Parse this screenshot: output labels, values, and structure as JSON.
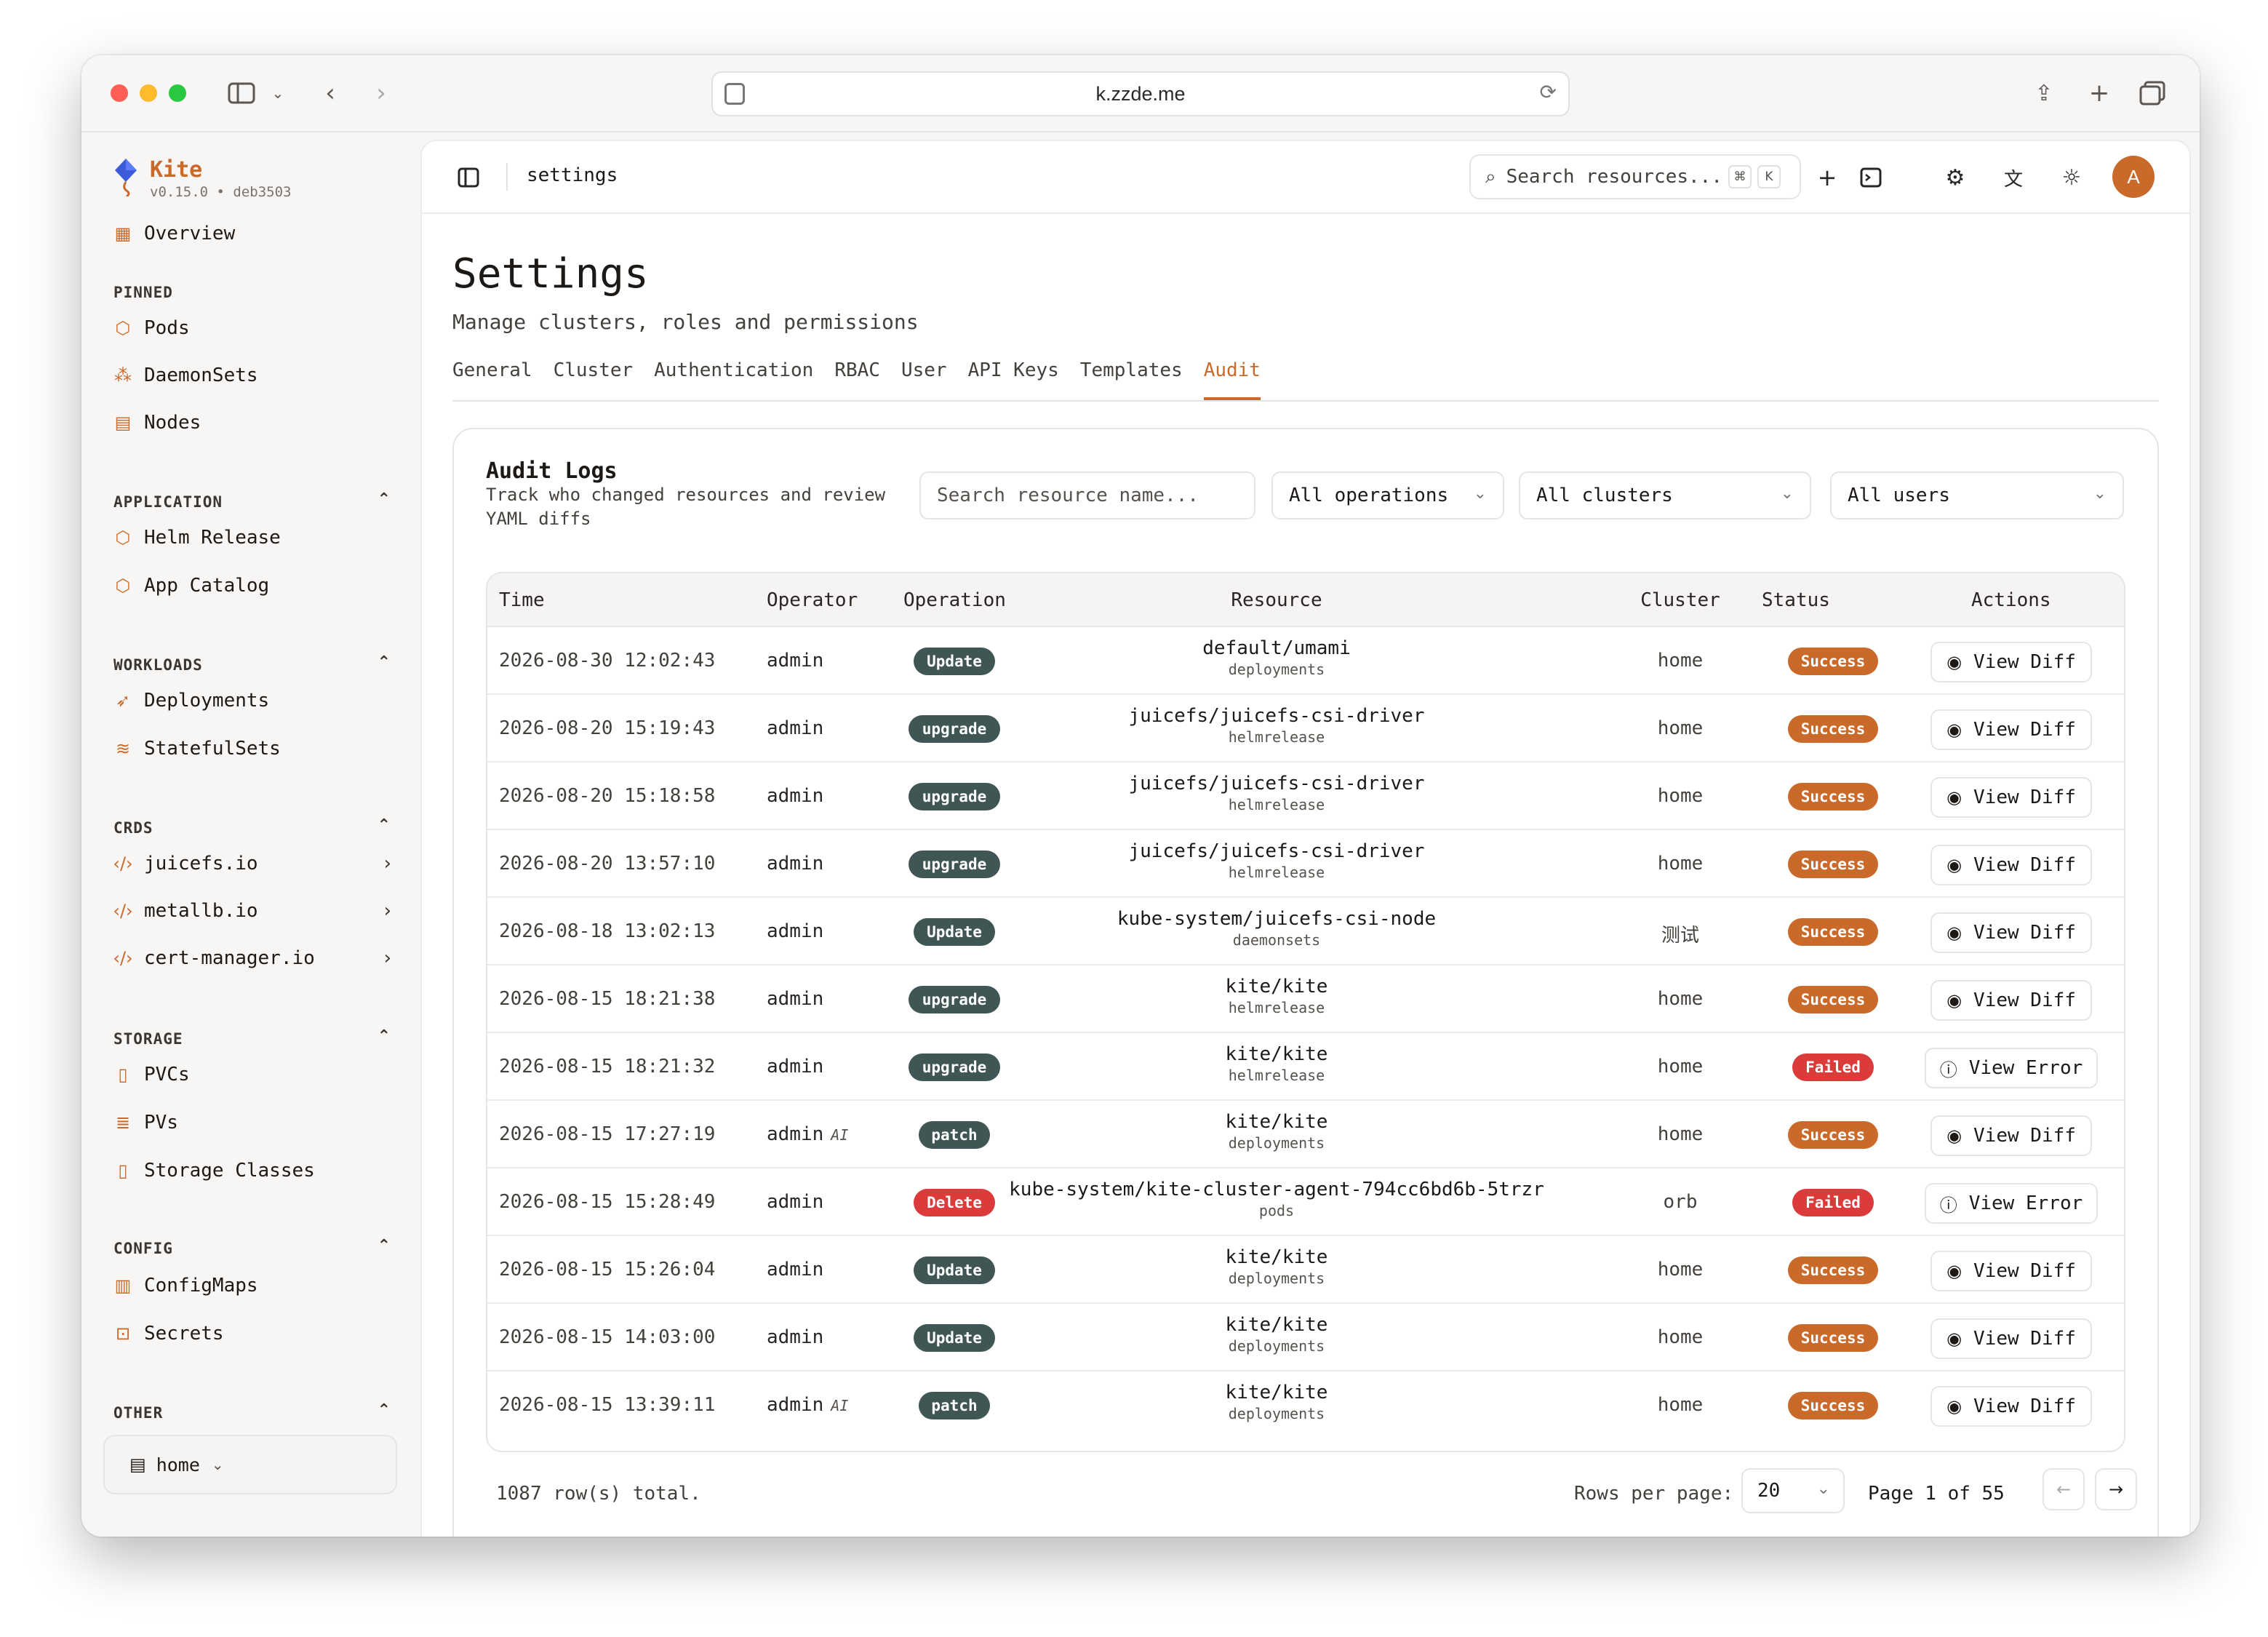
{
  "browser": {
    "url": "k.zzde.me"
  },
  "brand": {
    "name": "Kite",
    "version": "v0.15.0 • deb3503"
  },
  "sidebar": {
    "overview": "Overview",
    "sections": {
      "pinned": "PINNED",
      "application": "APPLICATION",
      "workloads": "WORKLOADS",
      "crds": "CRDS",
      "storage": "STORAGE",
      "config": "CONFIG",
      "other": "OTHER"
    },
    "pinned": [
      "Pods",
      "DaemonSets",
      "Nodes"
    ],
    "application": [
      "Helm Release",
      "App Catalog"
    ],
    "workloads": [
      "Deployments",
      "StatefulSets"
    ],
    "crds": [
      "juicefs.io",
      "metallb.io",
      "cert-manager.io"
    ],
    "storage": [
      "PVCs",
      "PVs",
      "Storage Classes"
    ],
    "config": [
      "ConfigMaps",
      "Secrets"
    ],
    "cluster": "home"
  },
  "header": {
    "breadcrumb": "settings",
    "search_placeholder": "Search resources...",
    "kbd_cmd": "⌘",
    "kbd_k": "K",
    "avatar": "A"
  },
  "page": {
    "title": "Settings",
    "subtitle": "Manage clusters, roles and permissions",
    "tabs": [
      "General",
      "Cluster",
      "Authentication",
      "RBAC",
      "User",
      "API Keys",
      "Templates",
      "Audit"
    ],
    "active_tab": "Audit"
  },
  "audit": {
    "title": "Audit Logs",
    "description": "Track who changed resources and review YAML diffs",
    "filters": {
      "search_placeholder": "Search resource name...",
      "operations": "All operations",
      "clusters": "All clusters",
      "users": "All users"
    },
    "columns": {
      "time": "Time",
      "operator": "Operator",
      "operation": "Operation",
      "resource": "Resource",
      "cluster": "Cluster",
      "status": "Status",
      "actions": "Actions"
    },
    "rows": [
      {
        "time": "2026-08-30 12:02:43",
        "operator": "admin",
        "ai": "",
        "operation": "Update",
        "resource": "default/umami",
        "kind": "deployments",
        "cluster": "home",
        "status": "Success",
        "action": "View Diff"
      },
      {
        "time": "2026-08-20 15:19:43",
        "operator": "admin",
        "ai": "",
        "operation": "upgrade",
        "resource": "juicefs/juicefs-csi-driver",
        "kind": "helmrelease",
        "cluster": "home",
        "status": "Success",
        "action": "View Diff"
      },
      {
        "time": "2026-08-20 15:18:58",
        "operator": "admin",
        "ai": "",
        "operation": "upgrade",
        "resource": "juicefs/juicefs-csi-driver",
        "kind": "helmrelease",
        "cluster": "home",
        "status": "Success",
        "action": "View Diff"
      },
      {
        "time": "2026-08-20 13:57:10",
        "operator": "admin",
        "ai": "",
        "operation": "upgrade",
        "resource": "juicefs/juicefs-csi-driver",
        "kind": "helmrelease",
        "cluster": "home",
        "status": "Success",
        "action": "View Diff"
      },
      {
        "time": "2026-08-18 13:02:13",
        "operator": "admin",
        "ai": "",
        "operation": "Update",
        "resource": "kube-system/juicefs-csi-node",
        "kind": "daemonsets",
        "cluster": "测试",
        "status": "Success",
        "action": "View Diff"
      },
      {
        "time": "2026-08-15 18:21:38",
        "operator": "admin",
        "ai": "",
        "operation": "upgrade",
        "resource": "kite/kite",
        "kind": "helmrelease",
        "cluster": "home",
        "status": "Success",
        "action": "View Diff"
      },
      {
        "time": "2026-08-15 18:21:32",
        "operator": "admin",
        "ai": "",
        "operation": "upgrade",
        "resource": "kite/kite",
        "kind": "helmrelease",
        "cluster": "home",
        "status": "Failed",
        "action": "View Error"
      },
      {
        "time": "2026-08-15 17:27:19",
        "operator": "admin",
        "ai": "AI",
        "operation": "patch",
        "resource": "kite/kite",
        "kind": "deployments",
        "cluster": "home",
        "status": "Success",
        "action": "View Diff"
      },
      {
        "time": "2026-08-15 15:28:49",
        "operator": "admin",
        "ai": "",
        "operation": "Delete",
        "resource": "kube-system/kite-cluster-agent-794cc6bd6b-5trzr",
        "kind": "pods",
        "cluster": "orb",
        "status": "Failed",
        "action": "View Error"
      },
      {
        "time": "2026-08-15 15:26:04",
        "operator": "admin",
        "ai": "",
        "operation": "Update",
        "resource": "kite/kite",
        "kind": "deployments",
        "cluster": "home",
        "status": "Success",
        "action": "View Diff"
      },
      {
        "time": "2026-08-15 14:03:00",
        "operator": "admin",
        "ai": "",
        "operation": "Update",
        "resource": "kite/kite",
        "kind": "deployments",
        "cluster": "home",
        "status": "Success",
        "action": "View Diff"
      },
      {
        "time": "2026-08-15 13:39:11",
        "operator": "admin",
        "ai": "AI",
        "operation": "patch",
        "resource": "kite/kite",
        "kind": "deployments",
        "cluster": "home",
        "status": "Success",
        "action": "View Diff"
      }
    ],
    "footer": {
      "total": "1087 row(s) total.",
      "rows_per_page_label": "Rows per page:",
      "rows_per_page": "20",
      "page_info": "Page 1 of 55"
    }
  },
  "colors": {
    "accent": "#c96a2a",
    "operation_badge": "#3f5654",
    "danger": "#dc3b3b"
  }
}
